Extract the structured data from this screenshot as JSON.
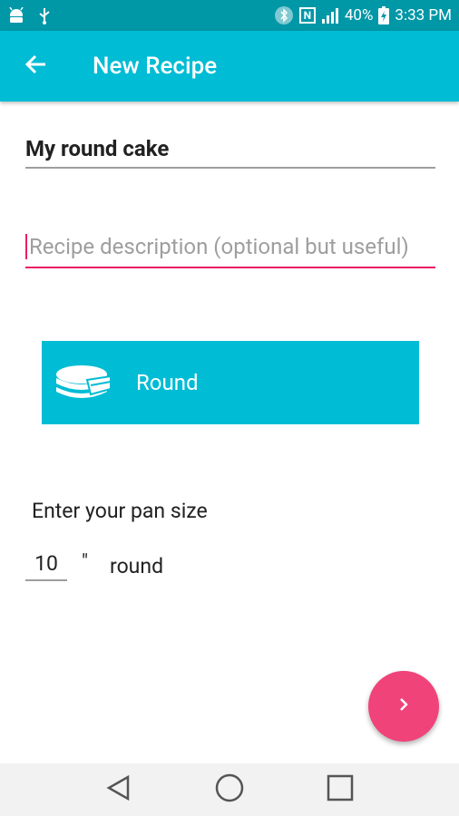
{
  "status_bar": {
    "battery": "40%",
    "time": "3:33 PM",
    "icons_left": [
      "android-icon",
      "usb-icon"
    ],
    "icons_right": [
      "bluetooth-icon",
      "nfc-icon",
      "signal-icon",
      "battery-icon"
    ]
  },
  "app_bar": {
    "title": "New Recipe",
    "back_icon": "arrow-back-icon",
    "color": "#00bcd4"
  },
  "form": {
    "name_value": "My round cake",
    "description_value": "",
    "description_placeholder": "Recipe description (optional but useful)"
  },
  "shape_button": {
    "label": "Round",
    "icon": "round-cake-pan-icon"
  },
  "pan_size": {
    "prompt": "Enter your pan size",
    "value": "10",
    "unit": "\"",
    "shape_word": "round"
  },
  "fab": {
    "icon": "chevron-right-icon",
    "color": "#f0437a"
  },
  "nav": {
    "icons": [
      "back-triangle-icon",
      "home-circle-icon",
      "recents-square-icon"
    ]
  },
  "colors": {
    "status_bar": "#0097a7",
    "accent": "#e91e63",
    "primary": "#00bcd4"
  }
}
